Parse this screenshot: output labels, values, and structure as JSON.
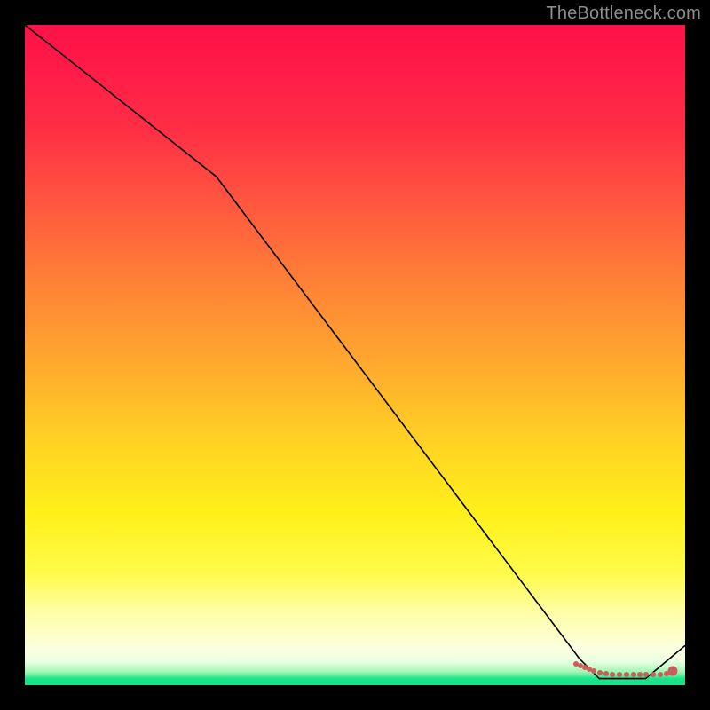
{
  "watermark": "TheBottleneck.com",
  "chart_data": {
    "type": "line",
    "title": "",
    "xlabel": "",
    "ylabel": "",
    "xlim": [
      0,
      100
    ],
    "ylim": [
      0,
      100
    ],
    "series": [
      {
        "name": "curve",
        "x": [
          0,
          29,
          84,
          87,
          94,
          100
        ],
        "y": [
          100,
          77,
          4,
          1,
          1,
          6
        ],
        "stroke": "#000000",
        "stroke_width": 1.6
      }
    ],
    "markers": {
      "name": "trough-markers",
      "color": "#cd5c5c",
      "points_plotxy": [
        [
          621,
          720
        ],
        [
          626,
          722
        ],
        [
          631,
          724
        ],
        [
          636,
          726
        ],
        [
          641,
          728
        ],
        [
          648,
          730
        ],
        [
          655,
          731
        ],
        [
          662,
          732
        ],
        [
          670,
          732
        ],
        [
          678,
          732
        ],
        [
          686,
          732
        ],
        [
          693,
          732
        ],
        [
          700,
          732
        ],
        [
          708,
          732
        ],
        [
          716,
          732
        ],
        [
          723,
          731
        ]
      ],
      "big_point_plotxy": [
        730,
        728
      ]
    }
  }
}
